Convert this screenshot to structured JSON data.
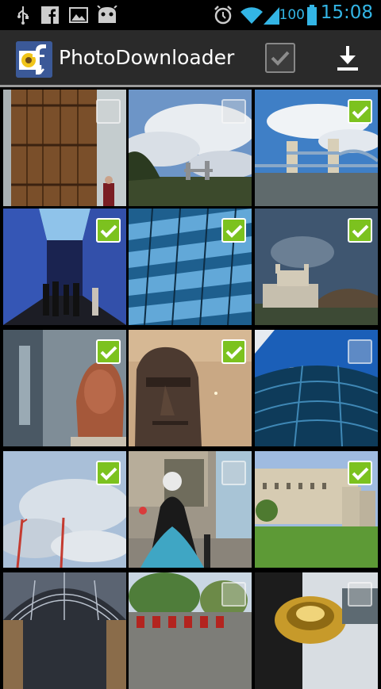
{
  "status_bar": {
    "icons": [
      "usb-icon",
      "facebook-icon",
      "gallery-icon",
      "android-debug-icon",
      "alarm-icon",
      "wifi-icon",
      "signal-icon",
      "battery-icon"
    ],
    "battery": "100",
    "time": "15:08"
  },
  "action_bar": {
    "title": "PhotoDownloader",
    "select_all_checked": true,
    "download_icon": "download-icon"
  },
  "colors": {
    "status_accent": "#33b5e5",
    "check_green": "#7cc21f",
    "actionbar_bg": "#2a2a2a"
  },
  "photos": [
    {
      "subject": "wooden door",
      "checked": false
    },
    {
      "subject": "cloudy skyline",
      "checked": false
    },
    {
      "subject": "tower bridge",
      "checked": true
    },
    {
      "subject": "museum corridor",
      "checked": true
    },
    {
      "subject": "glass building",
      "checked": true
    },
    {
      "subject": "tower of london",
      "checked": true
    },
    {
      "subject": "sphinx bust",
      "checked": true
    },
    {
      "subject": "stone head",
      "checked": true
    },
    {
      "subject": "glass dome",
      "checked": false
    },
    {
      "subject": "cranes sky",
      "checked": true
    },
    {
      "subject": "costumed figure",
      "checked": false
    },
    {
      "subject": "castle lawn",
      "checked": true
    },
    {
      "subject": "glass arcade",
      "checked": false
    },
    {
      "subject": "marching band",
      "checked": false
    },
    {
      "subject": "brass instrument",
      "checked": false
    }
  ]
}
